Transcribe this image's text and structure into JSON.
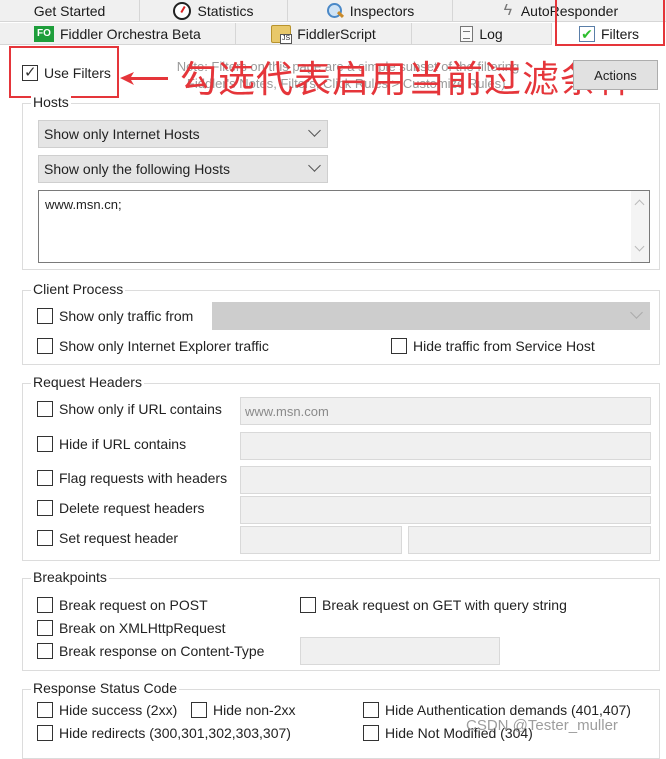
{
  "tabs": {
    "row1": [
      {
        "label": "Get Started",
        "icon": ""
      },
      {
        "label": "Statistics",
        "icon": "stopwatch-icon"
      },
      {
        "label": "Inspectors",
        "icon": "magnifier-icon"
      },
      {
        "label": "AutoResponder",
        "icon": "lightning-icon"
      }
    ],
    "row2": [
      {
        "label": "Fiddler Orchestra Beta",
        "icon": "fo-icon",
        "icon_text": "FO"
      },
      {
        "label": "FiddlerScript",
        "icon": "script-icon"
      },
      {
        "label": "Log",
        "icon": "log-icon"
      },
      {
        "label": "Filters",
        "icon": "check-icon",
        "active": true
      }
    ]
  },
  "use_filters": {
    "label": "Use Filters",
    "checked": true
  },
  "note": "Note: Filters on this page are a simple subset of the filtering Fiddler's Notes, Filters, Click Rules > Customize Rules).",
  "annotation": {
    "text": "勾选代表启用当前过滤条件",
    "color": "#e5353a"
  },
  "actions_button": {
    "label": "Actions"
  },
  "hosts": {
    "title": "Hosts",
    "zone_select": "Show only Internet Hosts",
    "host_select": "Show only the following Hosts",
    "host_list": "www.msn.cn;"
  },
  "client_process": {
    "title": "Client Process",
    "show_only_traffic_from": {
      "label": "Show only traffic from",
      "checked": false
    },
    "show_only_ie": {
      "label": "Show only Internet Explorer traffic",
      "checked": false
    },
    "hide_service_host": {
      "label": "Hide traffic from Service Host",
      "checked": false
    }
  },
  "request_headers": {
    "title": "Request Headers",
    "show_only_url": {
      "label": "Show only if URL contains",
      "checked": false,
      "placeholder": "www.msn.com"
    },
    "hide_url": {
      "label": "Hide if URL contains",
      "checked": false
    },
    "flag_headers": {
      "label": "Flag requests with headers",
      "checked": false
    },
    "delete_headers": {
      "label": "Delete request headers",
      "checked": false
    },
    "set_header": {
      "label": "Set request header",
      "checked": false
    }
  },
  "breakpoints": {
    "title": "Breakpoints",
    "post": {
      "label": "Break request on POST",
      "checked": false
    },
    "get_query": {
      "label": "Break request on GET with query string",
      "checked": false
    },
    "xhr": {
      "label": "Break on XMLHttpRequest",
      "checked": false
    },
    "content_type": {
      "label": "Break response on Content-Type",
      "checked": false
    }
  },
  "response_status": {
    "title": "Response Status Code",
    "hide_success": {
      "label": "Hide success (2xx)",
      "checked": false
    },
    "hide_non2xx": {
      "label": "Hide non-2xx",
      "checked": false
    },
    "hide_auth": {
      "label": "Hide Authentication demands (401,407)",
      "checked": false
    },
    "hide_redirects": {
      "label": "Hide redirects (300,301,302,303,307)",
      "checked": false
    },
    "hide_not_modified": {
      "label": "Hide Not Modified (304)",
      "checked": false
    }
  },
  "watermark": "CSDN @Tester_muller"
}
